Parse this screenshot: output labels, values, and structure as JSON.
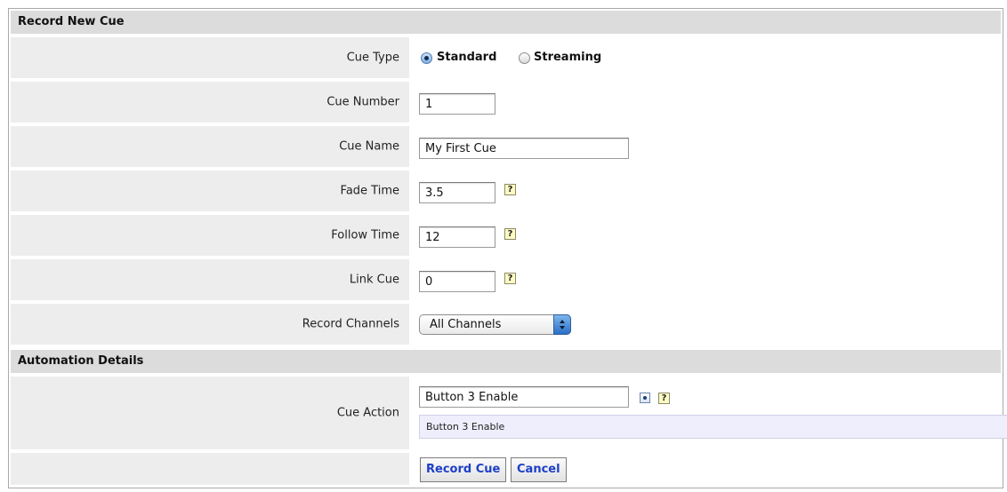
{
  "record_section": {
    "title": "Record New Cue"
  },
  "fields": {
    "cue_type": {
      "label": "Cue Type",
      "options": [
        {
          "label": "Standard",
          "selected": true
        },
        {
          "label": "Streaming",
          "selected": false
        }
      ]
    },
    "cue_number": {
      "label": "Cue Number",
      "value": "1"
    },
    "cue_name": {
      "label": "Cue Name",
      "value": "My First Cue"
    },
    "fade_time": {
      "label": "Fade Time",
      "value": "3.5",
      "help": "?"
    },
    "follow_time": {
      "label": "Follow Time",
      "value": "12",
      "help": "?"
    },
    "link_cue": {
      "label": "Link Cue",
      "value": "0",
      "help": "?"
    },
    "record_channels": {
      "label": "Record Channels",
      "value": "All Channels"
    }
  },
  "automation_section": {
    "title": "Automation Details"
  },
  "automation": {
    "cue_action": {
      "label": "Cue Action",
      "value": "Button 3 Enable",
      "help": "?",
      "preview": "Button 3 Enable"
    }
  },
  "buttons": {
    "record_label": "Record Cue",
    "cancel_label": "Cancel"
  },
  "colors": {
    "section_bg": "#dcdcdc",
    "label_bg": "#ededed",
    "button_text": "#1d3fc6",
    "help_bg": "#fdfbc3",
    "preview_bg": "#eeeefc"
  }
}
